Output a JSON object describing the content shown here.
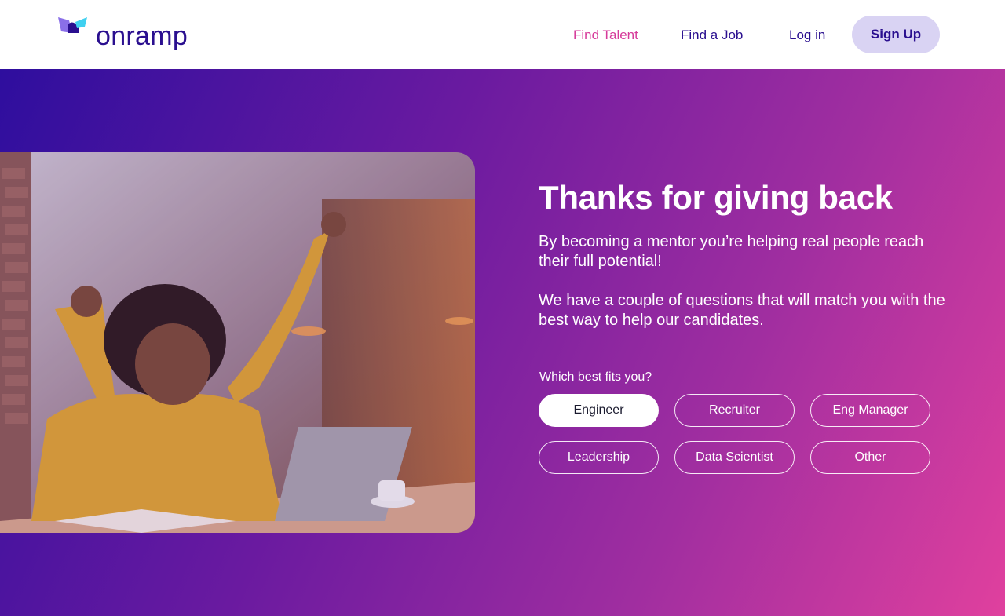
{
  "brand": {
    "name": "onramp"
  },
  "nav": {
    "find_talent": "Find Talent",
    "find_job": "Find a Job",
    "login": "Log in",
    "signup": "Sign Up"
  },
  "hero": {
    "title": "Thanks for giving back",
    "paragraph1": "By becoming a mentor you’re helping real people reach their full potential!",
    "paragraph2": "We have a couple of questions that will  match you with the best way to help our candidates.",
    "question": "Which best fits you?",
    "options": [
      {
        "label": "Engineer",
        "selected": true
      },
      {
        "label": "Recruiter",
        "selected": false
      },
      {
        "label": "Eng Manager",
        "selected": false
      },
      {
        "label": "Leadership",
        "selected": false
      },
      {
        "label": "Data Scientist",
        "selected": false
      },
      {
        "label": "Other",
        "selected": false
      }
    ]
  },
  "colors": {
    "brand_dark": "#2a0f8f",
    "accent_pink": "#d63a9a",
    "signup_bg": "#d9d3f3",
    "gradient_start": "#2e0e9e",
    "gradient_end": "#e0409e"
  },
  "photo": {
    "icon": "celebrating-woman-photo"
  }
}
